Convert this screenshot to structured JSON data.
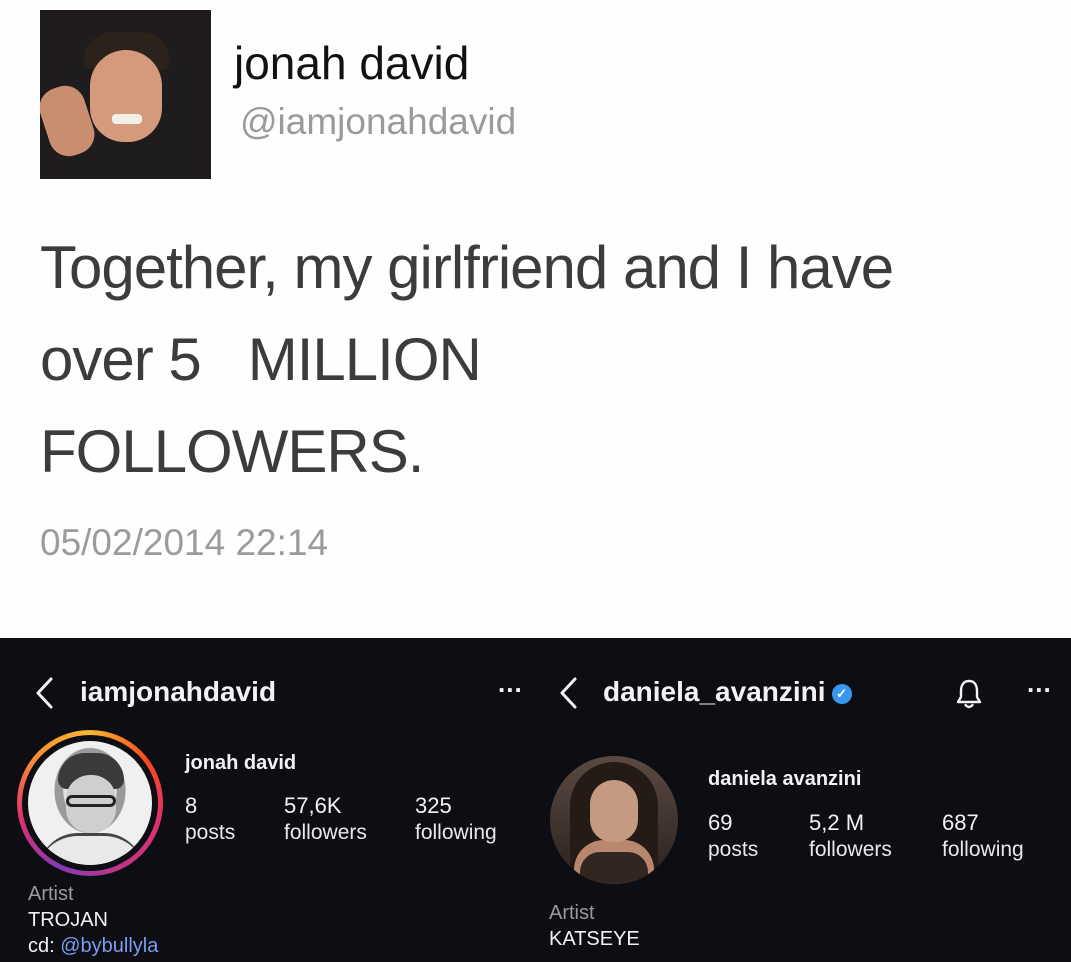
{
  "tweet": {
    "name": "jonah david",
    "handle": "@iamjonahdavid",
    "text_lines": [
      "Together, my girlfriend and I have",
      "over 5   MILLION",
      "FOLLOWERS."
    ],
    "date": "05/02/2014 22:14"
  },
  "left_profile": {
    "back_icon": "chevron-left-icon",
    "username": "iamjonahdavid",
    "more_label": "...",
    "full_name": "jonah david",
    "stats": [
      {
        "value": "8",
        "label": "posts"
      },
      {
        "value": "57,6K",
        "label": "followers"
      },
      {
        "value": "325",
        "label": "following"
      }
    ],
    "bio": {
      "category": "Artist",
      "line1": "TROJAN",
      "line2_prefix": "cd: ",
      "line2_link": "@bybullyla"
    },
    "story_ring": true
  },
  "right_profile": {
    "back_icon": "chevron-left-icon",
    "username": "daniela_avanzini",
    "verified": true,
    "bell_icon": "bell-icon",
    "more_label": "...",
    "full_name": "daniela avanzini",
    "stats": [
      {
        "value": "69",
        "label": "posts"
      },
      {
        "value": "5,2 M",
        "label": "followers"
      },
      {
        "value": "687",
        "label": "following"
      }
    ],
    "bio": {
      "category": "Artist",
      "line1": "KATSEYE"
    }
  },
  "colors": {
    "ig_background": "#0d0e13",
    "link": "#7b9cf0",
    "verified": "#3897f0",
    "tweet_text": "#3c3c3c",
    "tweet_muted": "#9b9b9b"
  }
}
